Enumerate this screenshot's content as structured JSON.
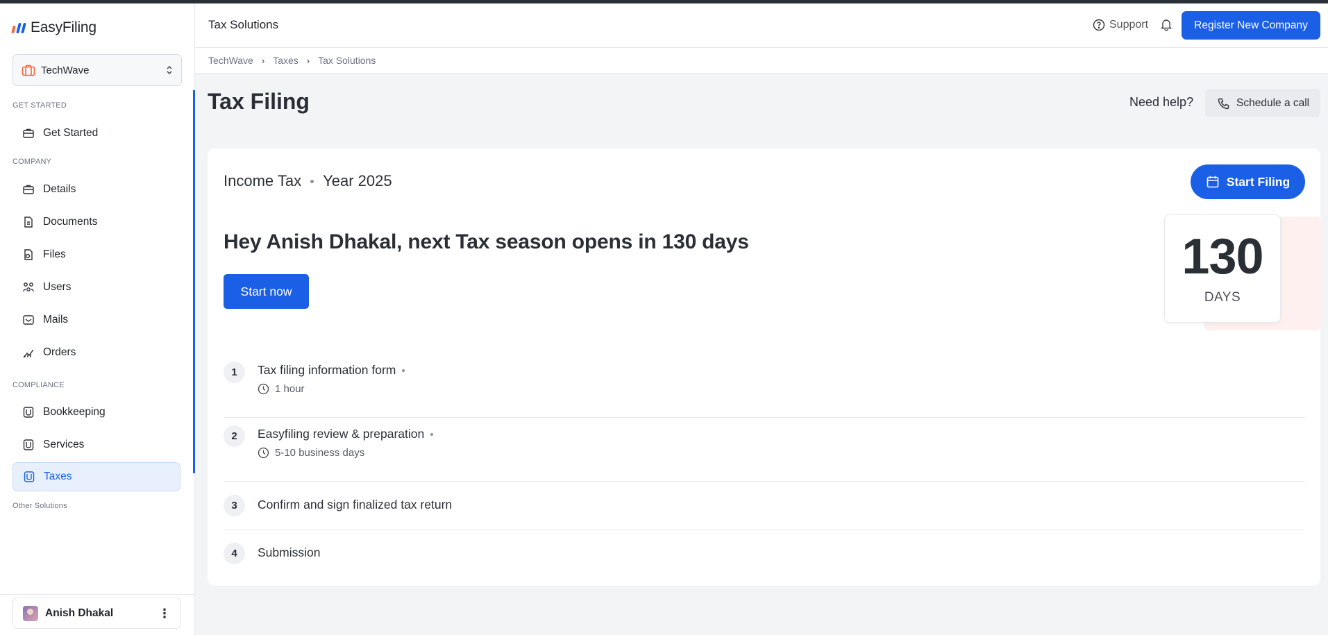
{
  "app": {
    "name": "EasyFiling"
  },
  "sidebar": {
    "company": "TechWave",
    "sections": {
      "get_started": "GET STARTED",
      "company": "COMPANY",
      "compliance": "COMPLIANCE",
      "other": "Other Solutions"
    },
    "items": {
      "get_started": "Get Started",
      "details": "Details",
      "documents": "Documents",
      "files": "Files",
      "users": "Users",
      "mails": "Mails",
      "orders": "Orders",
      "bookkeeping": "Bookkeeping",
      "services": "Services",
      "taxes": "Taxes"
    },
    "active_item": "taxes",
    "user": "Anish Dhakal"
  },
  "header": {
    "title": "Tax Solutions",
    "support": "Support",
    "register_button": "Register New Company"
  },
  "breadcrumb": [
    "TechWave",
    "Taxes",
    "Tax Solutions"
  ],
  "page": {
    "title": "Tax Filing",
    "need_help": "Need help?",
    "schedule_call": "Schedule a call"
  },
  "card": {
    "tax_type": "Income Tax",
    "year": "Year 2025",
    "start_filing": "Start Filing",
    "headline": "Hey Anish Dhakal, next Tax season opens in 130 days",
    "start_now": "Start now",
    "countdown": {
      "value": "130",
      "unit": "DAYS"
    },
    "steps": [
      {
        "num": "1",
        "title": "Tax filing information form",
        "time": "1 hour"
      },
      {
        "num": "2",
        "title": "Easyfiling review & preparation",
        "time": "5-10 business days"
      },
      {
        "num": "3",
        "title": "Confirm and sign finalized tax return"
      },
      {
        "num": "4",
        "title": "Submission"
      }
    ]
  },
  "colors": {
    "accent": "#1a5fe6",
    "logo_bars": [
      "#f2683b",
      "#1a5fe6",
      "#1a5fe6"
    ]
  }
}
